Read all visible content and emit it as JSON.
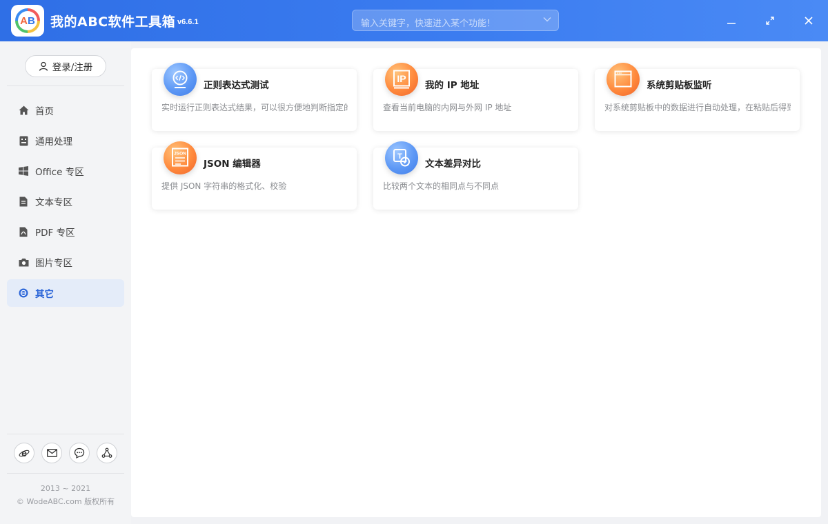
{
  "titlebar": {
    "app_name": "我的ABC软件工具箱",
    "version": "v6.6.1",
    "search_placeholder": "输入关键字，快速进入某个功能！"
  },
  "sidebar": {
    "login_label": "登录/注册",
    "items": [
      {
        "label": "首页",
        "icon": "home-icon"
      },
      {
        "label": "通用处理",
        "icon": "general-icon"
      },
      {
        "label": "Office 专区",
        "icon": "windows-icon"
      },
      {
        "label": "文本专区",
        "icon": "text-file-icon"
      },
      {
        "label": "PDF 专区",
        "icon": "pdf-file-icon"
      },
      {
        "label": "图片专区",
        "icon": "camera-icon"
      },
      {
        "label": "其它",
        "icon": "other-icon"
      }
    ],
    "active_item": "其它",
    "copyright_years": "2013 ~ 2021",
    "copyright_text": "© WodeABC.com 版权所有"
  },
  "tools": [
    {
      "title": "正则表达式测试",
      "desc": "实时运行正则表达式结果，可以很方便地判断指定的",
      "icon": "code-icon",
      "color": "blue"
    },
    {
      "title": "我的 IP 地址",
      "desc": "查看当前电脑的内网与外网 IP 地址",
      "icon": "ip-icon",
      "color": "orange"
    },
    {
      "title": "系统剪贴板监听",
      "desc": "对系统剪贴板中的数据进行自动处理，在粘贴后得到",
      "icon": "clipboard-window-icon",
      "color": "orange"
    },
    {
      "title": "JSON 编辑器",
      "desc": "提供 JSON 字符串的格式化、校验",
      "icon": "json-icon",
      "color": "orange"
    },
    {
      "title": "文本差异对比",
      "desc": "比较两个文本的相同点与不同点",
      "icon": "text-compare-icon",
      "color": "blue"
    }
  ],
  "icon_labels": {
    "ip": "IP",
    "json": "JSON",
    "t": "T"
  },
  "colors": {
    "titlebar": "#3273e9",
    "accent": "#2c66d8",
    "orange": "#ff8a3d",
    "blue": "#5d98f5"
  }
}
